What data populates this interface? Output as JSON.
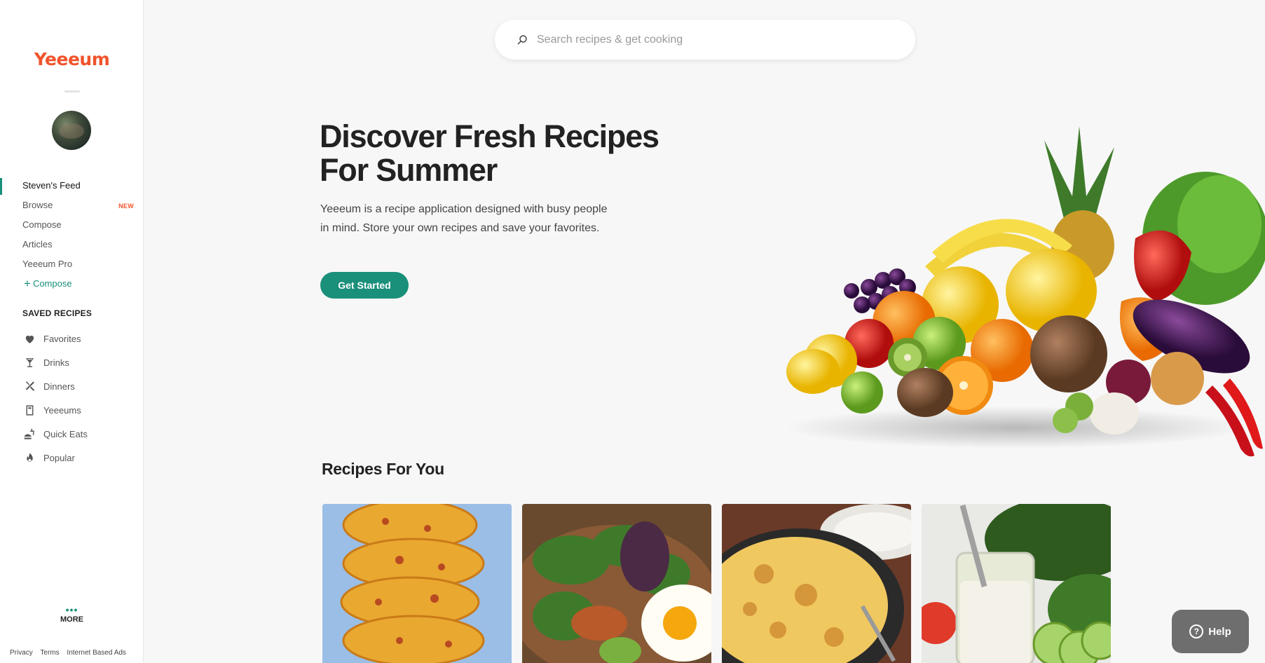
{
  "app": {
    "logo": "Yeeeum"
  },
  "search": {
    "placeholder": "Search recipes & get cooking"
  },
  "nav": {
    "items": [
      {
        "label": "Steven's Feed",
        "active": true
      },
      {
        "label": "Browse",
        "badge": "NEW"
      },
      {
        "label": "Compose"
      },
      {
        "label": "Articles"
      },
      {
        "label": "Yeeeum Pro"
      }
    ],
    "compose_link": "Compose"
  },
  "saved": {
    "title": "SAVED RECIPES",
    "items": [
      {
        "label": "Favorites",
        "icon": "heart-icon"
      },
      {
        "label": "Drinks",
        "icon": "martini-glass-icon"
      },
      {
        "label": "Dinners",
        "icon": "utensils-crossed-icon"
      },
      {
        "label": "Yeeeums",
        "icon": "book-icon"
      },
      {
        "label": "Quick Eats",
        "icon": "fast-food-icon"
      },
      {
        "label": "Popular",
        "icon": "flame-icon"
      }
    ]
  },
  "more": {
    "label": "MORE"
  },
  "footer": {
    "links": [
      "Privacy",
      "Terms",
      "Internet Based Ads"
    ]
  },
  "hero": {
    "title": "Discover Fresh Recipes For Summer",
    "description": "Yeeeum is a recipe application designed with busy people in mind. Store your own recipes and save your favorites.",
    "cta": "Get Started"
  },
  "recipes": {
    "title": "Recipes For You",
    "cards": [
      {
        "image": "stacked-cheesy-hashbrown-patties"
      },
      {
        "image": "salad-with-fried-egg"
      },
      {
        "image": "baked-mac-and-cheese-skillet"
      },
      {
        "image": "ranch-dressing-jar-with-salad"
      }
    ]
  },
  "help": {
    "label": "Help"
  },
  "colors": {
    "brand": "#f0542c",
    "accent": "#1a8f7a"
  }
}
